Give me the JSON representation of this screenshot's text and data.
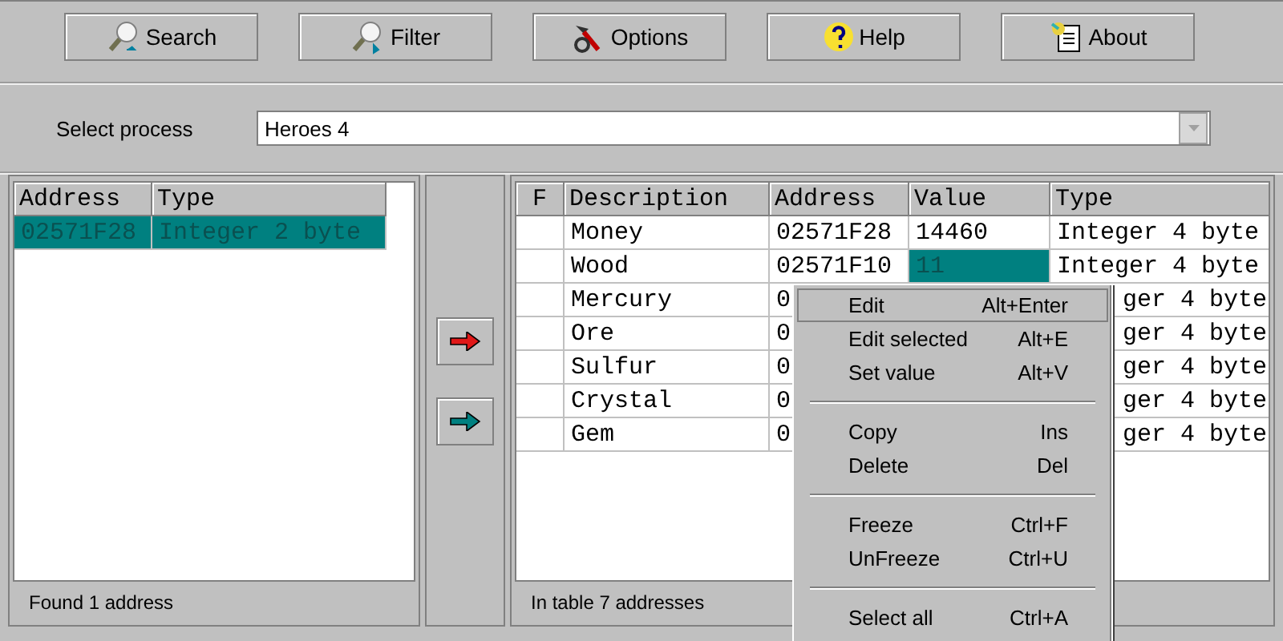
{
  "toolbar": [
    {
      "kind": "search",
      "label": "Search"
    },
    {
      "kind": "filter",
      "label": "Filter"
    },
    {
      "kind": "options",
      "label": "Options"
    },
    {
      "kind": "help",
      "label": "Help"
    },
    {
      "kind": "about",
      "label": "About"
    }
  ],
  "process": {
    "label": "Select process",
    "value": "Heroes 4"
  },
  "found": {
    "columns": [
      "Address",
      "Type"
    ],
    "rows": [
      {
        "address": "02571F28",
        "type": "Integer 2 byte",
        "selected": true
      }
    ],
    "status": "Found 1 address"
  },
  "transfer_buttons": [
    {
      "color": "#e01818"
    },
    {
      "color": "#008080"
    }
  ],
  "table": {
    "columns": [
      "F",
      "Description",
      "Address",
      "Value",
      "Type"
    ],
    "rows": [
      {
        "description": "Money",
        "address": "02571F28",
        "value": "14460",
        "type": "Integer 4 byte",
        "value_selected": false
      },
      {
        "description": "Wood",
        "address": "02571F10",
        "value": "11",
        "type": "Integer 4 byte",
        "value_selected": true
      },
      {
        "description": "Mercury",
        "address": "0",
        "type": "ger 4 byte"
      },
      {
        "description": "Ore",
        "address": "0",
        "type": "ger 4 byte"
      },
      {
        "description": "Sulfur",
        "address": "0",
        "type": "ger 4 byte"
      },
      {
        "description": "Crystal",
        "address": "0",
        "type": "ger 4 byte"
      },
      {
        "description": "Gem",
        "address": "0",
        "type": "ger 4 byte"
      }
    ],
    "status": "In table 7 addresses"
  },
  "context_menu": {
    "items": [
      {
        "kind": "item",
        "label": "Edit",
        "shortcut": "Alt+Enter",
        "selected": true
      },
      {
        "kind": "item",
        "label": "Edit selected",
        "shortcut": "Alt+E",
        "selected": false
      },
      {
        "kind": "item",
        "label": "Set value",
        "shortcut": "Alt+V",
        "selected": false
      },
      {
        "kind": "separator"
      },
      {
        "kind": "item",
        "label": "Copy",
        "shortcut": "Ins",
        "selected": false
      },
      {
        "kind": "item",
        "label": "Delete",
        "shortcut": "Del",
        "selected": false
      },
      {
        "kind": "separator"
      },
      {
        "kind": "item",
        "label": "Freeze",
        "shortcut": "Ctrl+F",
        "selected": false
      },
      {
        "kind": "item",
        "label": "UnFreeze",
        "shortcut": "Ctrl+U",
        "selected": false
      },
      {
        "kind": "separator"
      },
      {
        "kind": "item",
        "label": "Select all",
        "shortcut": "Ctrl+A",
        "selected": false
      }
    ]
  }
}
